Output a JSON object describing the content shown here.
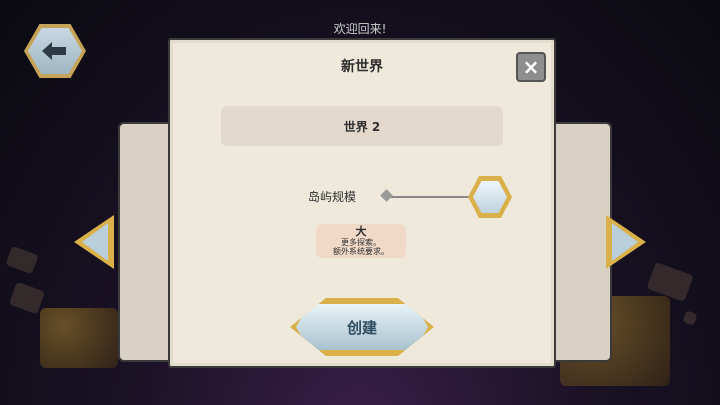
{
  "header": {
    "welcome_text": "欢迎回来!"
  },
  "dialog": {
    "title": "新世界",
    "world_name": "世界 2",
    "size_label": "岛屿规模",
    "size_value": "大",
    "size_desc_line1": "更多探索。",
    "size_desc_line2": "额外系统要求。",
    "create_label": "创建"
  },
  "icons": {
    "back": "arrow-left-icon",
    "close": "close-icon",
    "nav_left": "chevron-left-icon",
    "nav_right": "chevron-right-icon"
  },
  "colors": {
    "parchment": "#efe9dc",
    "gold_frame": "#d9b04a",
    "button_blue": "#a8c2cf",
    "desc_bg": "#f1d9c8"
  }
}
